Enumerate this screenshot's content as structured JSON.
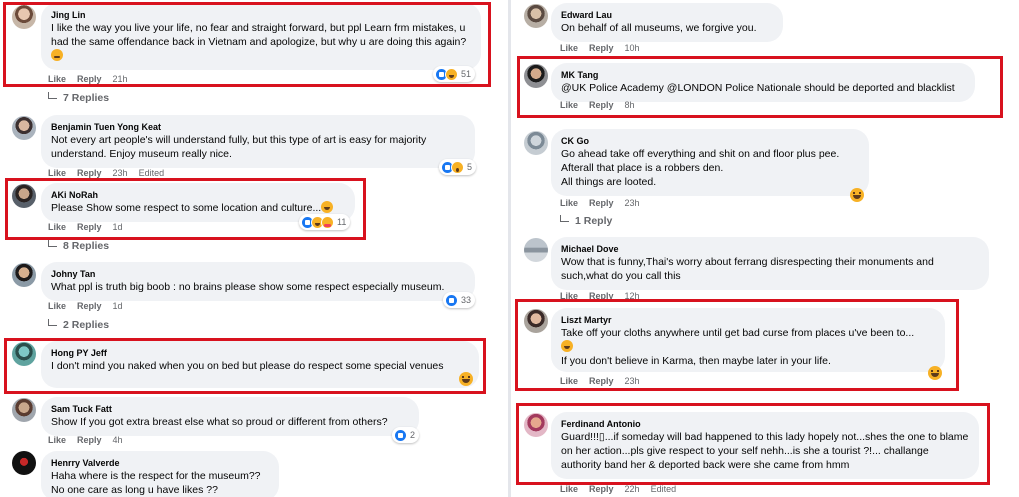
{
  "actions": {
    "like": "Like",
    "reply": "Reply",
    "edited": "Edited"
  },
  "colors": {
    "highlight": "#d8121e",
    "bubble": "#f0f2f5",
    "meta": "#65676b",
    "like_blue": "#1877f2"
  },
  "left": {
    "comments": [
      {
        "author": "Jing Lin",
        "text": "I like the way you live your life, no fear and straight forward, but ppl Learn frm mistakes, u had the same offendance back in Vietnam and apologize, but why u are doing this again?",
        "time": "21h",
        "reaction_count": "51",
        "replies": "7 Replies"
      },
      {
        "author": "Benjamin Tuen Yong Keat",
        "text": "Not every art people's will understand fully, but this type of art is easy for majority understand. Enjoy museum really nice.",
        "time": "23h",
        "edited": "Edited",
        "reaction_count": "5"
      },
      {
        "author": "AKi NoRah",
        "text": "Please Show some respect to some location and culture...",
        "time": "1d",
        "reaction_count": "11",
        "replies": "8 Replies"
      },
      {
        "author": "Johny Tan",
        "text": "What ppl is truth big boob : no brains please show some respect especially museum.",
        "time": "1d",
        "reaction_count": "33",
        "replies": "2 Replies"
      },
      {
        "author": "Hong PY Jeff",
        "text": "I don't mind you naked when you on bed but please do respect some special venues"
      },
      {
        "author": "Sam Tuck Fatt",
        "text": "Show If you got extra breast else what so proud or different from others?",
        "time": "4h",
        "reaction_count": "2"
      },
      {
        "author": "Henrry Valverde",
        "text_line1": "Haha where is the respect for the museum??",
        "text_line2": "No one care as long u have likes ??"
      }
    ]
  },
  "right": {
    "comments": [
      {
        "author": "Edward Lau",
        "text": "On behalf of all museums, we forgive you.",
        "time": "10h"
      },
      {
        "author": "MK Tang",
        "text": "@UK Police Academy @LONDON Police Nationale should be deported and blacklist",
        "time": "8h"
      },
      {
        "author": "CK Go",
        "text_line1": "Go ahead take off everything and shit on and floor plus pee.",
        "text_line2": "Afterall that place is a robbers den.",
        "text_line3": "All things are looted.",
        "time": "23h",
        "replies": "1 Reply"
      },
      {
        "author": "Michael Dove",
        "text": "Wow that is funny,Thai's worry about ferrang disrespecting their monuments and such,what do you call this",
        "time": "12h"
      },
      {
        "author": "Liszt Martyr",
        "text_line1": "Take off your cloths anywhere until get bad curse from places u've been to...",
        "text_line2": "If you don't believe in Karma, then maybe later in your life.",
        "time": "23h"
      },
      {
        "author": "Ferdinand Antonio",
        "text": "Guard!!!▯...if someday will bad happened to this lady hopely not...shes the one to blame on her action...pls give respect to your self nehh...is she a tourist ?!... challange authority band her & deported back were she came from hmm",
        "time": "22h",
        "edited": "Edited"
      }
    ]
  }
}
